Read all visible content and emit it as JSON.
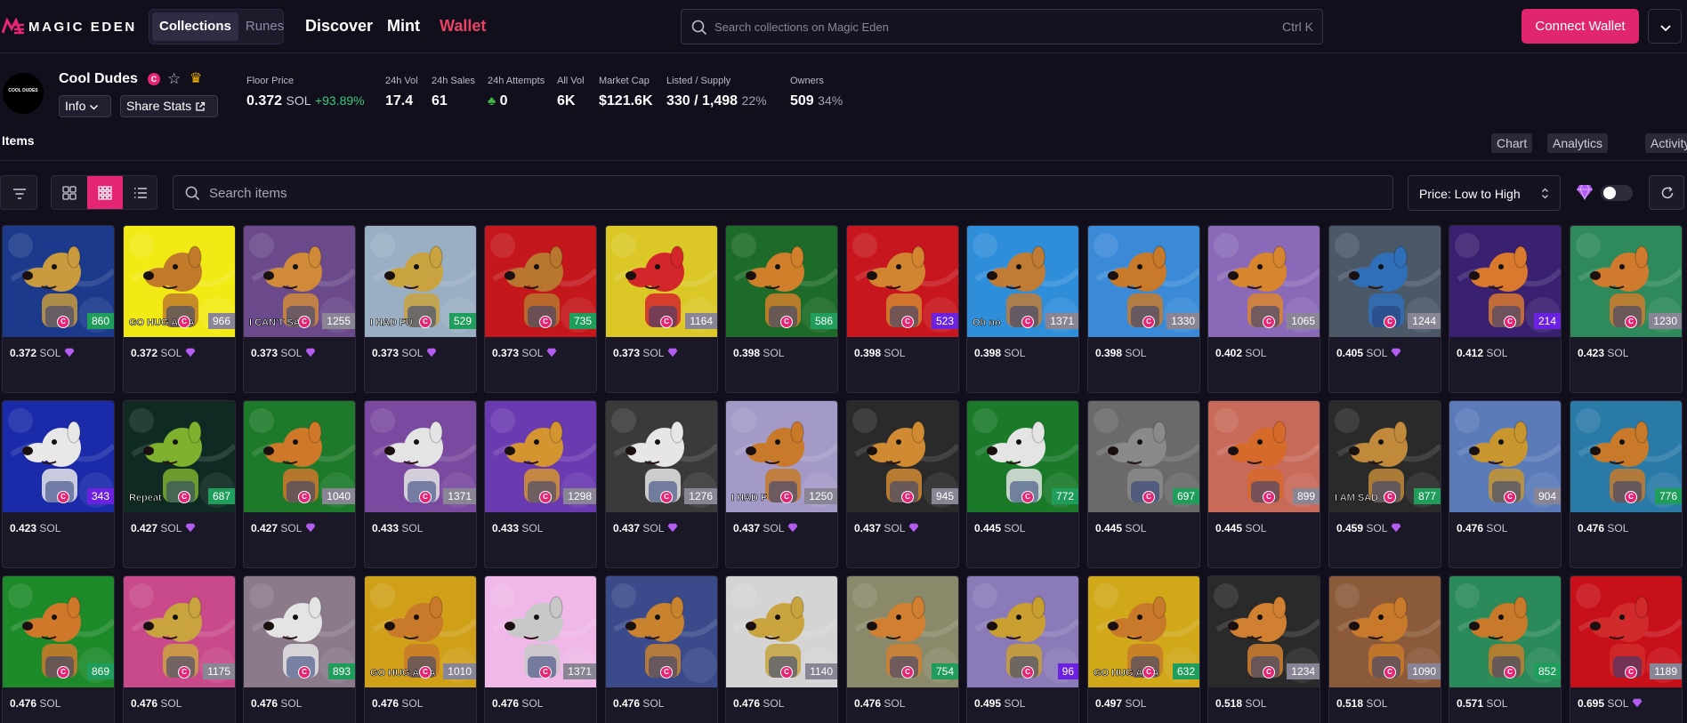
{
  "nav": {
    "logo_text": "MAGIC EDEN",
    "tabs": [
      "Collections",
      "Runes"
    ],
    "links": [
      "Discover",
      "Mint",
      "Wallet"
    ],
    "search_placeholder": "Search collections on Magic Eden",
    "search_shortcut": "Ctrl K",
    "connect_label": "Connect Wallet"
  },
  "collection": {
    "avatar_text": "COOL DUDES",
    "name": "Cool Dudes",
    "badge": "C",
    "info_label": "Info",
    "share_label": "Share Stats",
    "stats": {
      "floor": {
        "label": "Floor Price",
        "value": "0.372",
        "unit": "SOL",
        "change": "+93.89%"
      },
      "vol24": {
        "label": "24h Vol",
        "value": "17.4"
      },
      "sales24": {
        "label": "24h Sales",
        "value": "61"
      },
      "attempts24": {
        "label": "24h Attempts",
        "value": "0"
      },
      "allvol": {
        "label": "All Vol",
        "value": "6K"
      },
      "mcap": {
        "label": "Market Cap",
        "value": "$121.6K"
      },
      "listed": {
        "label": "Listed / Supply",
        "value": "330 / 1,498",
        "pct": "22%"
      },
      "owners": {
        "label": "Owners",
        "value": "509",
        "pct": "34%"
      }
    }
  },
  "items": {
    "title": "Items",
    "tabs": [
      "Chart",
      "Analytics",
      "Activity"
    ],
    "search_placeholder": "Search items",
    "sort_label": "Price: Low to High",
    "list": [
      {
        "rank": "860",
        "price": "0.372",
        "gem": true,
        "bg": "#1b3a8c",
        "fur": "#c99a3e",
        "rankColor": "#1e9e5a",
        "label": ""
      },
      {
        "rank": "966",
        "price": "0.372",
        "gem": true,
        "bg": "#f2ea14",
        "fur": "#c07a2a",
        "rankColor": "#8a8594",
        "label": "GO HUG A CA"
      },
      {
        "rank": "1255",
        "price": "0.373",
        "gem": true,
        "bg": "#6a4a8a",
        "fur": "#d08a38",
        "rankColor": "#8a8594",
        "label": "I CAN'T SA"
      },
      {
        "rank": "529",
        "price": "0.373",
        "gem": true,
        "bg": "#9aaec4",
        "fur": "#c9a340",
        "rankColor": "#1e9e5a",
        "label": "I HAD FU"
      },
      {
        "rank": "735",
        "price": "0.373",
        "gem": true,
        "bg": "#c3171c",
        "fur": "#b8762e",
        "rankColor": "#1e9e5a",
        "label": ""
      },
      {
        "rank": "1164",
        "price": "0.373",
        "gem": true,
        "bg": "#dbc826",
        "fur": "#d3262b",
        "rankColor": "#8a8594",
        "label": ""
      },
      {
        "rank": "586",
        "price": "0.398",
        "gem": false,
        "bg": "#1d6b28",
        "fur": "#d07f2a",
        "rankColor": "#1e9e5a",
        "label": ""
      },
      {
        "rank": "523",
        "price": "0.398",
        "gem": false,
        "bg": "#c8161e",
        "fur": "#d28530",
        "rankColor": "#6a22e0",
        "label": ""
      },
      {
        "rank": "1371",
        "price": "0.398",
        "gem": false,
        "bg": "#2f8ed9",
        "fur": "#c07c34",
        "rankColor": "#8a8594",
        "label": "Oh no"
      },
      {
        "rank": "1330",
        "price": "0.398",
        "gem": false,
        "bg": "#3a8ad8",
        "fur": "#c87a2a",
        "rankColor": "#8a8594",
        "label": ""
      },
      {
        "rank": "1065",
        "price": "0.402",
        "gem": false,
        "bg": "#8a6ab8",
        "fur": "#d8862e",
        "rankColor": "#8a8594",
        "label": ""
      },
      {
        "rank": "1244",
        "price": "0.405",
        "gem": true,
        "bg": "#4a5868",
        "fur": "#2f6fb8",
        "rankColor": "#8a8594",
        "label": ""
      },
      {
        "rank": "214",
        "price": "0.412",
        "gem": false,
        "bg": "#3a2070",
        "fur": "#d8792e",
        "rankColor": "#6a22e0",
        "label": ""
      },
      {
        "rank": "1230",
        "price": "0.423",
        "gem": false,
        "bg": "#2e8a5a",
        "fur": "#d07a2e",
        "rankColor": "#8a8594",
        "label": ""
      },
      {
        "rank": "343",
        "price": "0.423",
        "gem": false,
        "bg": "#1a2aa8",
        "fur": "#e8e8e8",
        "rankColor": "#6a22e0",
        "label": ""
      },
      {
        "rank": "687",
        "price": "0.427",
        "gem": true,
        "bg": "#0e2a22",
        "fur": "#7fb02e",
        "rankColor": "#1e9e5a",
        "label": "Repeat"
      },
      {
        "rank": "1040",
        "price": "0.427",
        "gem": true,
        "bg": "#1d7a2a",
        "fur": "#d0782a",
        "rankColor": "#8a8594",
        "label": ""
      },
      {
        "rank": "1371",
        "price": "0.433",
        "gem": false,
        "bg": "#7a4aa0",
        "fur": "#e4e4e4",
        "rankColor": "#8a8594",
        "label": ""
      },
      {
        "rank": "1298",
        "price": "0.433",
        "gem": false,
        "bg": "#6a3ab0",
        "fur": "#d49530",
        "rankColor": "#8a8594",
        "label": ""
      },
      {
        "rank": "1276",
        "price": "0.437",
        "gem": true,
        "bg": "#3a3a3a",
        "fur": "#e6e6e6",
        "rankColor": "#8a8594",
        "label": ""
      },
      {
        "rank": "1250",
        "price": "0.437",
        "gem": true,
        "bg": "#a49ac8",
        "fur": "#c87a2a",
        "rankColor": "#8a8594",
        "label": "I HAD F"
      },
      {
        "rank": "945",
        "price": "0.437",
        "gem": true,
        "bg": "#2a2a2a",
        "fur": "#d08a32",
        "rankColor": "#8a8594",
        "label": ""
      },
      {
        "rank": "772",
        "price": "0.445",
        "gem": false,
        "bg": "#1a7a2a",
        "fur": "#e4e4e4",
        "rankColor": "#1e9e5a",
        "label": ""
      },
      {
        "rank": "697",
        "price": "0.445",
        "gem": false,
        "bg": "#6a6a6a",
        "fur": "#8a8a8a",
        "rankColor": "#1e9e5a",
        "label": ""
      },
      {
        "rank": "899",
        "price": "0.445",
        "gem": false,
        "bg": "#c86a5a",
        "fur": "#d66a2a",
        "rankColor": "#8a8594",
        "label": ""
      },
      {
        "rank": "877",
        "price": "0.459",
        "gem": true,
        "bg": "#2a2a2a",
        "fur": "#c08a3a",
        "rankColor": "#1e9e5a",
        "label": "I AM SAD"
      },
      {
        "rank": "904",
        "price": "0.476",
        "gem": false,
        "bg": "#5a7ab8",
        "fur": "#c8952e",
        "rankColor": "#8a8594",
        "label": ""
      },
      {
        "rank": "776",
        "price": "0.476",
        "gem": false,
        "bg": "#2a7aa8",
        "fur": "#c87a2a",
        "rankColor": "#1e9e5a",
        "label": ""
      },
      {
        "rank": "869",
        "price": "0.476",
        "gem": false,
        "bg": "#1d8a2a",
        "fur": "#d0782a",
        "rankColor": "#1e9e5a",
        "label": ""
      },
      {
        "rank": "1175",
        "price": "0.476",
        "gem": false,
        "bg": "#c84a8a",
        "fur": "#c9a33e",
        "rankColor": "#8a8594",
        "label": ""
      },
      {
        "rank": "893",
        "price": "0.476",
        "gem": false,
        "bg": "#8a7a8a",
        "fur": "#e4e4e4",
        "rankColor": "#1e9e5a",
        "label": ""
      },
      {
        "rank": "1010",
        "price": "0.476",
        "gem": false,
        "bg": "#d0a018",
        "fur": "#c87a2a",
        "rankColor": "#8a8594",
        "label": "GO HUG A CA"
      },
      {
        "rank": "1371",
        "price": "0.476",
        "gem": false,
        "bg": "#f0b8e8",
        "fur": "#c8c8c8",
        "rankColor": "#8a8594",
        "label": ""
      },
      {
        "rank": "",
        "price": "0.476",
        "gem": false,
        "bg": "#3a4a8a",
        "fur": "#c9822e",
        "rankColor": "#8a8594",
        "label": ""
      },
      {
        "rank": "1140",
        "price": "0.476",
        "gem": false,
        "bg": "#d4d4d4",
        "fur": "#c8a33e",
        "rankColor": "#8a8594",
        "label": ""
      },
      {
        "rank": "754",
        "price": "0.476",
        "gem": false,
        "bg": "#8a8a6a",
        "fur": "#d08030",
        "rankColor": "#1e9e5a",
        "label": ""
      },
      {
        "rank": "96",
        "price": "0.495",
        "gem": false,
        "bg": "#8a7ab8",
        "fur": "#c9a030",
        "rankColor": "#6a22e0",
        "label": ""
      },
      {
        "rank": "632",
        "price": "0.497",
        "gem": false,
        "bg": "#d0a818",
        "fur": "#c87a2a",
        "rankColor": "#1e9e5a",
        "label": "GO HUG A CA"
      },
      {
        "rank": "1234",
        "price": "0.518",
        "gem": false,
        "bg": "#2a2a2a",
        "fur": "#d08030",
        "rankColor": "#8a8594",
        "label": ""
      },
      {
        "rank": "1090",
        "price": "0.518",
        "gem": false,
        "bg": "#8a5a3a",
        "fur": "#c87a2a",
        "rankColor": "#8a8594",
        "label": ""
      },
      {
        "rank": "852",
        "price": "0.571",
        "gem": false,
        "bg": "#2a8a5a",
        "fur": "#c87a2a",
        "rankColor": "#1e9e5a",
        "label": ""
      },
      {
        "rank": "1189",
        "price": "0.695",
        "gem": true,
        "bg": "#c8101a",
        "fur": "#d02a2a",
        "rankColor": "#8a8594",
        "label": ""
      }
    ]
  },
  "unit": "SOL",
  "colors": {
    "accent": "#e42575",
    "wallet": "#ea4262",
    "up": "#3cc779"
  }
}
